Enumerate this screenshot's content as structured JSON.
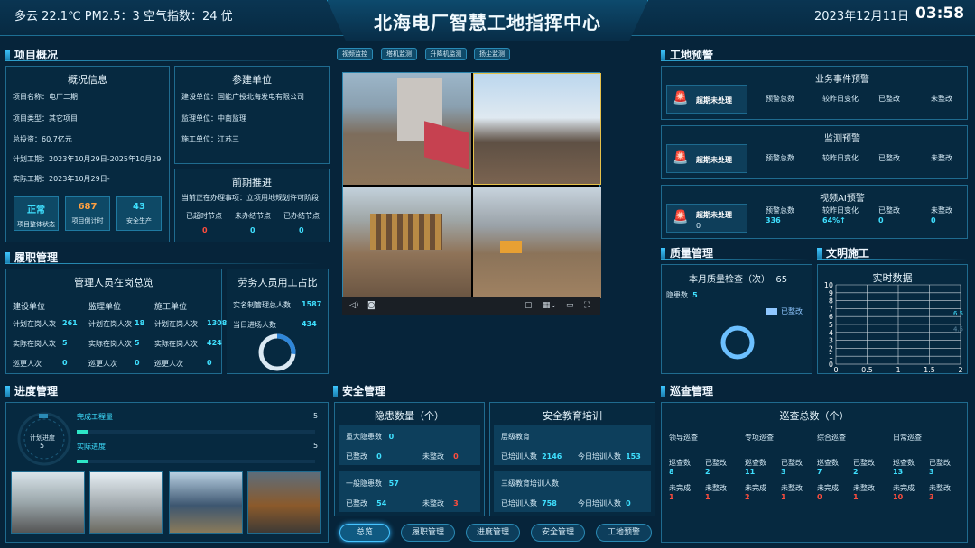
{
  "header": {
    "weather": "多云 22.1℃ PM2.5：3 空气指数：24 优",
    "title": "北海电厂智慧工地指挥中心",
    "date": "2023年12月11日",
    "time": "03:58"
  },
  "project": {
    "section": "项目概况",
    "overview": {
      "title": "概况信息",
      "name": "项目名称：电厂二期",
      "type": "项目类型：其它项目",
      "invest": "总投资：60.7亿元",
      "plan": "计划工期：2023年10月29日-2025年10月29",
      "actual": "实际工期：2023年10月29日-"
    },
    "kpis": [
      {
        "value": "正常",
        "label": "项目整体状态"
      },
      {
        "value": "687",
        "label": "项目倒计时"
      },
      {
        "value": "43",
        "label": "安全生产"
      }
    ],
    "units": {
      "title": "参建单位",
      "build": "建设单位：国能广投北海发电有限公司",
      "supervise": "监理单位：中南监理",
      "construct": "施工单位：江苏三"
    },
    "prep": {
      "title": "前期推进",
      "todo": "当前正在办理事项：立项用地规划许可阶段",
      "cols": [
        "已超时节点",
        "未办结节点",
        "已办结节点"
      ],
      "vals": [
        "0",
        "0",
        "0"
      ]
    }
  },
  "duty": {
    "section": "履职管理",
    "personnel": {
      "title": "管理人员在岗总览",
      "cols": [
        "建设单位",
        "监理单位",
        "施工单位"
      ],
      "rows": [
        {
          "label": "计划在岗人次",
          "vals": [
            "261",
            "18",
            "1308"
          ]
        },
        {
          "label": "实际在岗人次",
          "vals": [
            "5",
            "5",
            "424"
          ]
        },
        {
          "label": "巡更人次",
          "vals": [
            "0",
            "0",
            "0"
          ]
        }
      ]
    },
    "labor": {
      "title": "劳务人员用工占比",
      "total_label": "实名制管理总人数",
      "total": "1587",
      "today_label": "当日进场人数",
      "today": "434"
    }
  },
  "video": {
    "tabs": [
      "视频监控",
      "塔机监测",
      "升降机监测",
      "扬尘监测"
    ]
  },
  "warning": {
    "section": "工地预警",
    "blocks": [
      {
        "title": "业务事件预警",
        "alert": "超期未处理",
        "count": "",
        "cols": [
          "预警总数",
          "较昨日变化",
          "已整改",
          "未整改"
        ],
        "vals": [
          "",
          "",
          "",
          ""
        ]
      },
      {
        "title": "监测预警",
        "alert": "超期未处理",
        "count": "",
        "cols": [
          "预警总数",
          "较昨日变化",
          "已整改",
          "未整改"
        ],
        "vals": [
          "",
          "",
          "",
          ""
        ]
      },
      {
        "title": "视频AI预警",
        "alert": "超期未处理",
        "count": "0",
        "cols": [
          "预警总数",
          "较昨日变化",
          "已整改",
          "未整改"
        ],
        "vals": [
          "336",
          "64%↑",
          "0",
          "0"
        ]
      }
    ]
  },
  "quality": {
    "section": "质量管理",
    "title": "本月质量检查（次）",
    "count": "65",
    "hazard_label": "隐患数",
    "hazard": "5",
    "legend": "已整改"
  },
  "civil": {
    "section": "文明施工",
    "title": "实时数据",
    "yticks": [
      "0",
      "1",
      "2",
      "3",
      "4",
      "5",
      "6",
      "7",
      "8",
      "9",
      "10"
    ],
    "xticks": [
      "0",
      "0.5",
      "1",
      "1.5",
      "2"
    ],
    "point_labels": [
      "6.5",
      "4.5"
    ]
  },
  "progress": {
    "section": "进度管理",
    "ring_label": "计划进度",
    "ring_value": "5",
    "items": [
      {
        "label": "完成工程量",
        "value": "5"
      },
      {
        "label": "实际进度",
        "value": "5"
      }
    ]
  },
  "safety": {
    "section": "安全管理",
    "hazard": {
      "title": "隐患数量（个）",
      "major": {
        "label": "重大隐患数",
        "value": "0",
        "fixed_label": "已整改",
        "fixed": "0",
        "unfixed_label": "未整改",
        "unfixed": "0"
      },
      "general": {
        "label": "一般隐患数",
        "value": "57",
        "fixed_label": "已整改",
        "fixed": "54",
        "unfixed_label": "未整改",
        "unfixed": "3"
      }
    },
    "training": {
      "title": "安全教育培训",
      "level3": {
        "label": "层级教育",
        "trained_label": "已培训人数",
        "trained": "2146",
        "today_label": "今日培训人数",
        "today": "153"
      },
      "three": {
        "label": "三级教育培训人数",
        "trained_label": "已培训人数",
        "trained": "758",
        "today_label": "今日培训人数",
        "today": "0"
      }
    }
  },
  "patrol": {
    "section": "巡查管理",
    "title": "巡查总数（个）",
    "groups": [
      {
        "name": "领导巡查",
        "a_label": "巡查数",
        "a": "8",
        "b_label": "已整改",
        "b": "2",
        "c_label": "未完成",
        "c": "1",
        "d_label": "未整改",
        "d": "1"
      },
      {
        "name": "专项巡查",
        "a_label": "巡查数",
        "a": "11",
        "b_label": "已整改",
        "b": "3",
        "c_label": "未完成",
        "c": "2",
        "d_label": "未整改",
        "d": "1"
      },
      {
        "name": "综合巡查",
        "a_label": "巡查数",
        "a": "7",
        "b_label": "已整改",
        "b": "2",
        "c_label": "未完成",
        "c": "0",
        "d_label": "未整改",
        "d": "1"
      },
      {
        "name": "日常巡查",
        "a_label": "巡查数",
        "a": "13",
        "b_label": "已整改",
        "b": "3",
        "c_label": "未完成",
        "c": "10",
        "d_label": "未整改",
        "d": "3"
      }
    ]
  },
  "nav": [
    "总览",
    "履职管理",
    "进度管理",
    "安全管理",
    "工地预警"
  ],
  "colors": {
    "accent": "#3fe0ff",
    "alert": "#ff4d3d",
    "warn": "#ffa040"
  }
}
